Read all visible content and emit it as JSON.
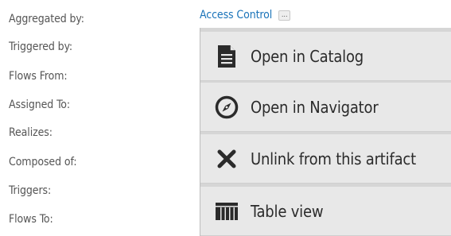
{
  "properties": {
    "labels": [
      "Aggregated by:",
      "Triggered by:",
      "Flows From:",
      "Assigned To:",
      "Realizes:",
      "Composed of:",
      "Triggers:",
      "Flows To:"
    ],
    "aggregated_by_value": "Access Control",
    "more_button_label": "..."
  },
  "context_menu": {
    "items": [
      {
        "label": "Open in Catalog",
        "icon": "document-icon"
      },
      {
        "label": "Open in Navigator",
        "icon": "compass-icon"
      },
      {
        "label": "Unlink from this artifact",
        "icon": "close-x-icon"
      },
      {
        "label": "Table view",
        "icon": "table-view-icon"
      }
    ]
  },
  "colors": {
    "label_text": "#555555",
    "link_text": "#1a73b9",
    "menu_background": "#e8e8e8",
    "menu_text": "#2b2b2b",
    "icon_fill": "#2b2b2b"
  }
}
